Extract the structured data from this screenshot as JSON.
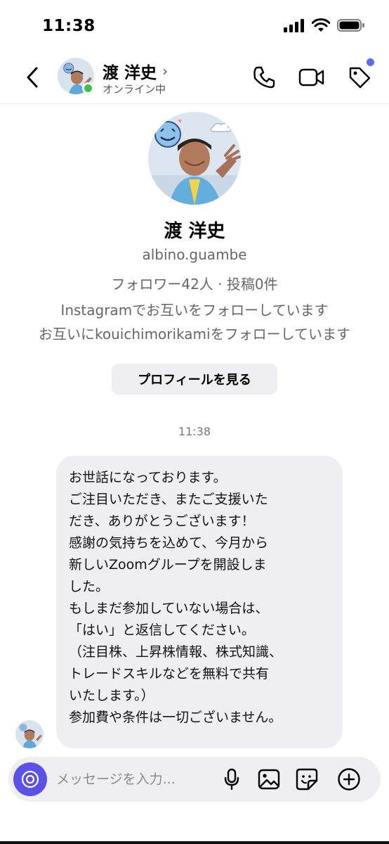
{
  "status_bar": {
    "time": "11:38"
  },
  "header": {
    "name": "渡 洋史",
    "chevron": "›",
    "status": "オンライン中",
    "icons": [
      "back-icon",
      "phone-icon",
      "video-icon",
      "tag-icon"
    ]
  },
  "profile": {
    "name": "渡 洋史",
    "username": "albino.guambe",
    "stats": "フォロワー42人 · 投稿0件",
    "mutual_line_1": "Instagramでお互いをフォローしています",
    "mutual_line_2": "お互いにkouichimorikamiをフォローしています",
    "view_profile_label": "プロフィールを見る"
  },
  "conversation": {
    "timestamp": "11:38",
    "message_lines": [
      "お世話になっております。",
      "ご注目いただき、またご支援いた",
      "だき、ありがとうございます！",
      "感謝の気持ちを込めて、今月から",
      "新しいZoomグループを開設しま",
      "した。",
      "もしまだ参加していない場合は、",
      "「はい」と返信してください。",
      "（注目株、上昇株情報、株式知識、",
      "トレードスキルなどを無料で共有",
      "いたします。）",
      "参加費や条件は一切ございません。"
    ]
  },
  "composer": {
    "placeholder": "メッセージを入力...",
    "icons": [
      "camera-icon",
      "microphone-icon",
      "image-icon",
      "sticker-icon",
      "plus-icon"
    ]
  },
  "colors": {
    "accent": "#5b50e8",
    "online": "#3fbf4d",
    "bubble": "#efeff3",
    "notification_dot": "#5b6cf0"
  }
}
